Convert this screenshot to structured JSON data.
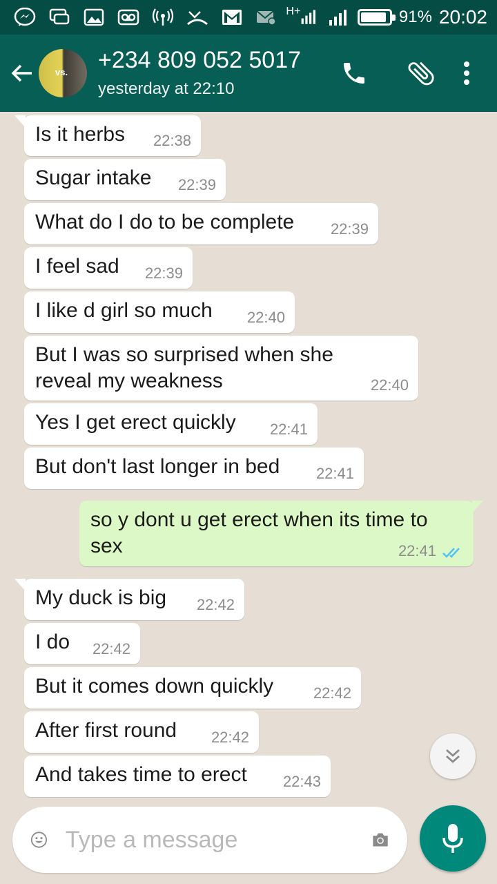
{
  "status_bar": {
    "battery_percent": "91%",
    "battery_level": 0.91,
    "time": "20:02",
    "network_label": "H+",
    "icons": [
      "messenger-icon",
      "chat-icon",
      "image-icon",
      "voicemail-icon",
      "hotspot-icon",
      "missed-call-icon",
      "gmail-icon",
      "email-icon",
      "signal-icon",
      "battery-icon"
    ]
  },
  "header": {
    "contact_name": "+234 809 052 5017",
    "last_seen": "yesterday at 22:10",
    "avatar_text": "vs.",
    "actions": [
      "phone-icon",
      "attach-icon",
      "more-icon"
    ]
  },
  "messages": [
    {
      "direction": "in",
      "text": "Is it herbs",
      "time": "22:38"
    },
    {
      "direction": "in",
      "text": "Sugar intake",
      "time": "22:39"
    },
    {
      "direction": "in",
      "text": "What do I do to be complete",
      "time": "22:39"
    },
    {
      "direction": "in",
      "text": "I feel sad",
      "time": "22:39"
    },
    {
      "direction": "in",
      "text": "I like d girl so much",
      "time": "22:40"
    },
    {
      "direction": "in",
      "text": "But I was so surprised when she reveal my weakness",
      "time": "22:40"
    },
    {
      "direction": "in",
      "text": "Yes I get erect quickly",
      "time": "22:41"
    },
    {
      "direction": "in",
      "text": "But don't last longer in bed",
      "time": "22:41"
    },
    {
      "direction": "out",
      "text": "so y dont u get erect when its time to sex",
      "time": "22:41",
      "status": "read"
    },
    {
      "direction": "in",
      "text": "My duck is big",
      "time": "22:42"
    },
    {
      "direction": "in",
      "text": "I do",
      "time": "22:42"
    },
    {
      "direction": "in",
      "text": "But it comes down quickly",
      "time": "22:42"
    },
    {
      "direction": "in",
      "text": "After first round",
      "time": "22:42"
    },
    {
      "direction": "in",
      "text": "And takes time to erect",
      "time": "22:43"
    }
  ],
  "input": {
    "placeholder": "Type a message"
  },
  "colors": {
    "header": "#075e54",
    "status_bar": "#054d44",
    "incoming_bubble": "#ffffff",
    "outgoing_bubble": "#dcf8c6",
    "chat_background": "#e6ddd4",
    "mic_button": "#00897b",
    "read_ticks": "#4fc3f7"
  }
}
